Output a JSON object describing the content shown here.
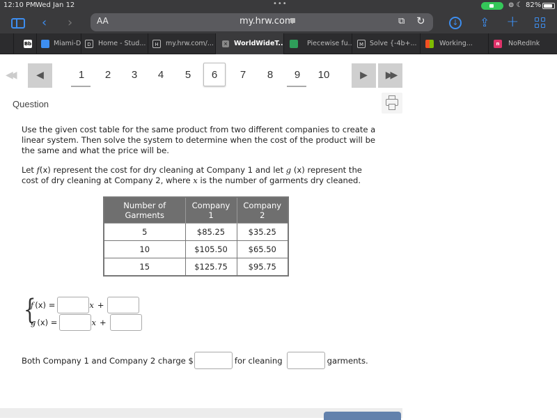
{
  "status_bar": {
    "time": "12:10 PM",
    "date": "Wed Jan 12",
    "battery": "82%"
  },
  "browser": {
    "text_size_label": "AA",
    "url": "my.hrw.com",
    "tabs": [
      {
        "label": "",
        "favicon": "Bb",
        "favicon_color": "#ffffff"
      },
      {
        "label": "Miami-Da",
        "favicon": "safari-icon",
        "favicon_color": "#3d8ef0"
      },
      {
        "label": "Home - Stud...",
        "favicon": "D",
        "favicon_color": "#2c2c2e"
      },
      {
        "label": "my.hrw.com/...",
        "favicon": "H",
        "favicon_color": "#2c2c2e"
      },
      {
        "label": "WorldWideT...",
        "favicon": "x",
        "favicon_color": "#888888",
        "active": true
      },
      {
        "label": "Piecewise fu...",
        "favicon": "desmos-icon",
        "favicon_color": "#2f9e5a"
      },
      {
        "label": "Solve {-4b+...",
        "favicon": "M",
        "favicon_color": "#2c2c2e"
      },
      {
        "label": "Working...",
        "favicon": "microsoft-icon",
        "favicon_color": "#f25022"
      },
      {
        "label": "NoRedInk",
        "favicon": "n",
        "favicon_color": "#e0336a"
      }
    ]
  },
  "pager": {
    "pages": [
      "1",
      "2",
      "3",
      "4",
      "5",
      "6",
      "7",
      "8",
      "9",
      "10"
    ],
    "current": "6",
    "visited": [
      "1",
      "9"
    ]
  },
  "question": {
    "heading": "Question",
    "paragraph1": "Use the given cost table for the same product from two different companies to create a linear system. Then solve the system to determine when the cost of the product will be the same and what the price will be.",
    "p2_a": "Let ",
    "p2_f": "f",
    "p2_fx": "(x)",
    "p2_b": " represent the cost for dry cleaning at Company 1 and let ",
    "p2_g": "g",
    "p2_gx": " (x)",
    "p2_c": " represent the cost of dry cleaning at Company 2, where ",
    "p2_x": "x",
    "p2_d": " is the number of garments dry cleaned."
  },
  "table": {
    "headers": [
      [
        "Number of",
        "Garments"
      ],
      [
        "Company",
        "1"
      ],
      [
        "Company",
        "2"
      ]
    ],
    "rows": [
      [
        "5",
        "$85.25",
        "$35.25"
      ],
      [
        "10",
        "$105.50",
        "$65.50"
      ],
      [
        "15",
        "$125.75",
        "$95.75"
      ]
    ]
  },
  "system": {
    "f_label": "f",
    "f_arg": "(x) =",
    "g_label": "g",
    "g_arg": " (x) =",
    "x_term": "x",
    "plus": "+",
    "f_slope_value": "",
    "f_intercept_value": "",
    "g_slope_value": "",
    "g_intercept_value": ""
  },
  "answer": {
    "part1": "Both Company 1 and Company 2 charge $",
    "part2": "for cleaning",
    "part3": "garments.",
    "price_value": "",
    "garments_value": ""
  }
}
